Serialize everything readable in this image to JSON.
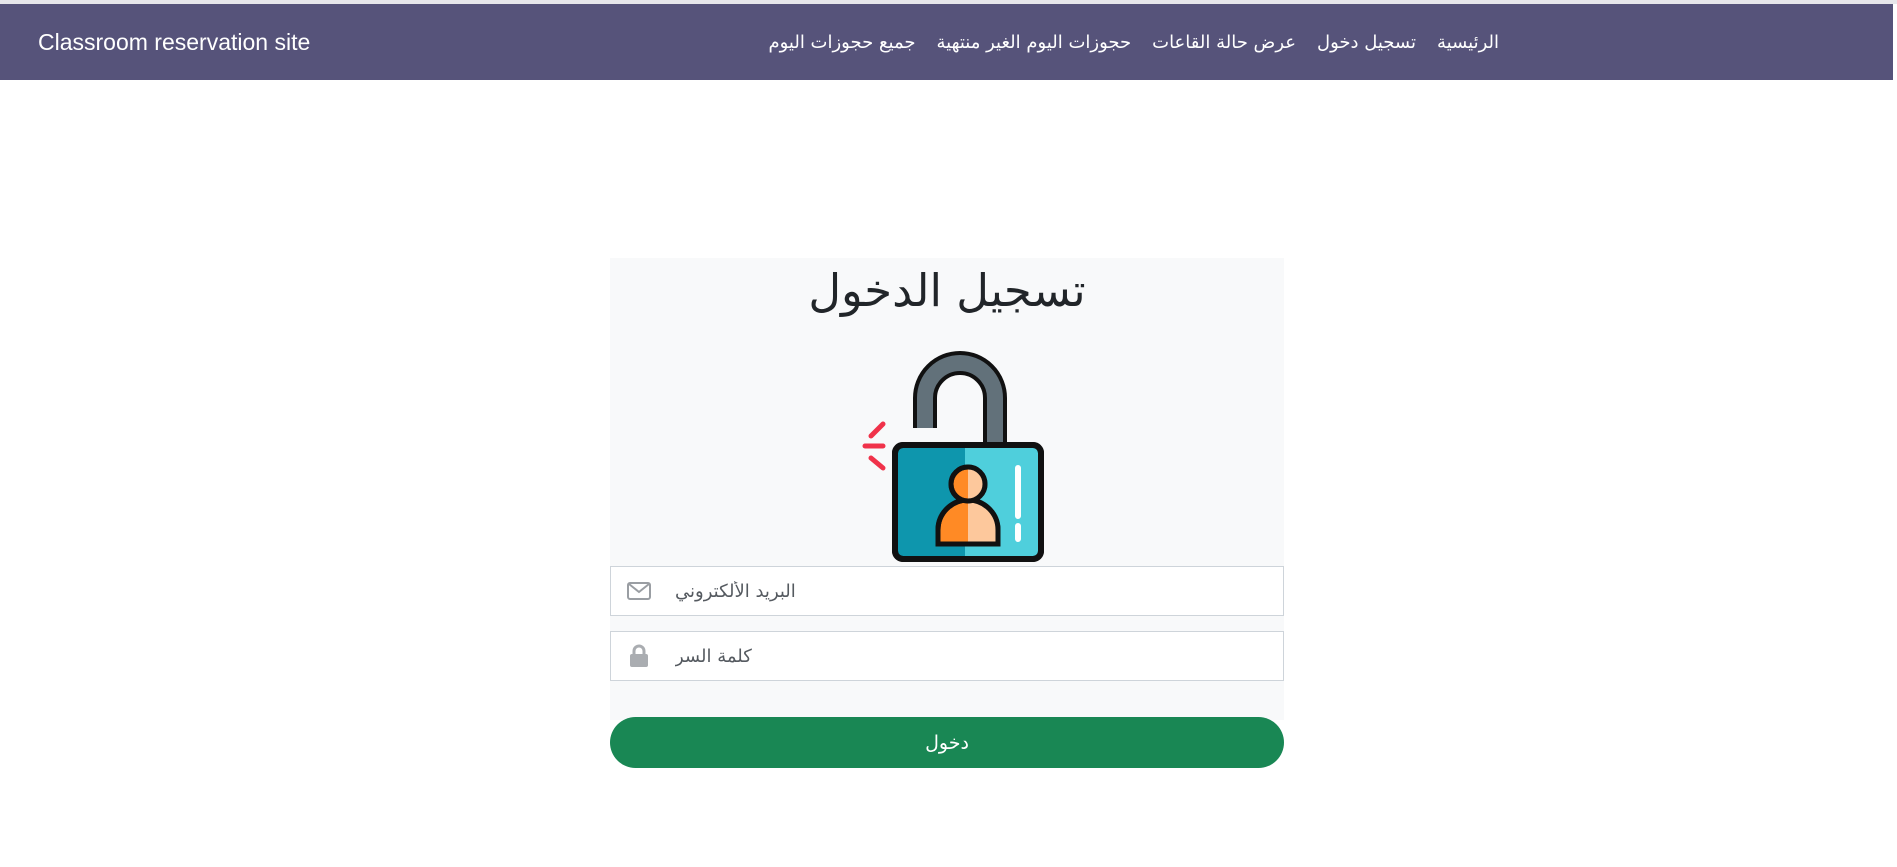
{
  "navbar": {
    "brand": "Classroom reservation site",
    "links": [
      {
        "label": "الرئيسية"
      },
      {
        "label": "تسجيل دخول"
      },
      {
        "label": "عرض حالة القاعات"
      },
      {
        "label": "حجوزات اليوم الغير منتهية"
      },
      {
        "label": "جميع حجوزات اليوم"
      }
    ]
  },
  "login": {
    "title": "تسجيل الدخول",
    "email_placeholder": "البريد الألكتروني",
    "password_placeholder": "كلمة السر",
    "submit_label": "دخول"
  },
  "icons": {
    "illustration": "unlocked-padlock-user-icon",
    "email": "envelope-icon",
    "password": "lock-icon"
  },
  "colors": {
    "navbar": "#56537a",
    "button": "#198754",
    "card": "#f8f9fa"
  }
}
